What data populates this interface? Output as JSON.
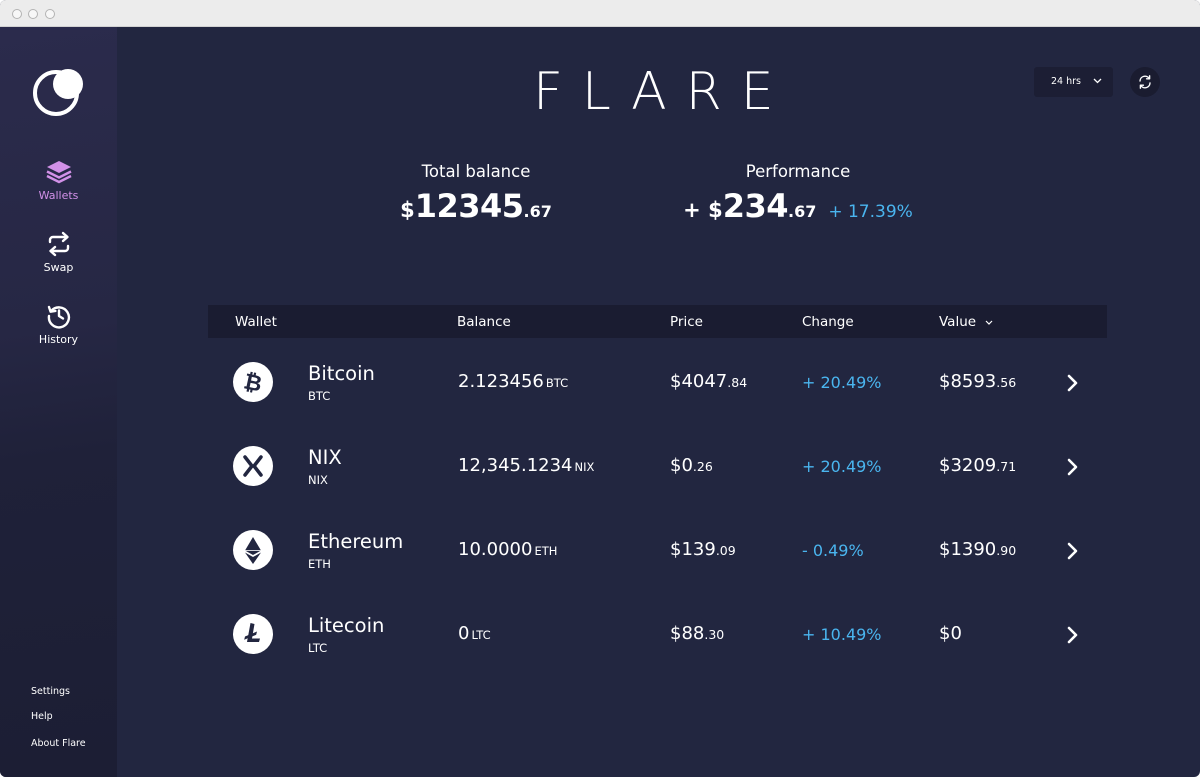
{
  "app": {
    "brand": "FLARE"
  },
  "sidebar": {
    "nav": [
      {
        "label": "Wallets",
        "icon": "layers-icon",
        "active": true
      },
      {
        "label": "Swap",
        "icon": "swap-arrows-icon",
        "active": false
      },
      {
        "label": "History",
        "icon": "history-clock-icon",
        "active": false
      }
    ],
    "footer": [
      "Settings",
      "Help",
      "About Flare"
    ]
  },
  "header": {
    "range": "24 hrs"
  },
  "summary": {
    "total_label": "Total balance",
    "total_currency": "$",
    "total_whole": "12345",
    "total_cents": ".67",
    "perf_label": "Performance",
    "perf_prefix": "+ $",
    "perf_whole": "234",
    "perf_cents": ".67",
    "perf_percent": "+ 17.39%"
  },
  "table": {
    "headers": {
      "wallet": "Wallet",
      "balance": "Balance",
      "price": "Price",
      "change": "Change",
      "value": "Value"
    },
    "rows": [
      {
        "name": "Bitcoin",
        "symbol": "BTC",
        "icon": "bitcoin-icon",
        "balance": "2.123456",
        "unit": "BTC",
        "price_whole": "$4047",
        "price_cents": ".84",
        "change": "+ 20.49%",
        "value_whole": "$8593",
        "value_cents": ".56"
      },
      {
        "name": "NIX",
        "symbol": "NIX",
        "icon": "nix-icon",
        "balance": "12,345.1234",
        "unit": "NIX",
        "price_whole": "$0",
        "price_cents": ".26",
        "change": "+ 20.49%",
        "value_whole": "$3209",
        "value_cents": ".71"
      },
      {
        "name": "Ethereum",
        "symbol": "ETH",
        "icon": "ethereum-icon",
        "balance": "10.0000",
        "unit": "ETH",
        "price_whole": "$139",
        "price_cents": ".09",
        "change": "- 0.49%",
        "value_whole": "$1390",
        "value_cents": ".90"
      },
      {
        "name": "Litecoin",
        "symbol": "LTC",
        "icon": "litecoin-icon",
        "balance": "0",
        "unit": "LTC",
        "price_whole": "$88",
        "price_cents": ".30",
        "change": "+ 10.49%",
        "value_whole": "$0",
        "value_cents": ""
      }
    ]
  },
  "colors": {
    "background": "#222640",
    "accent": "#d291e8",
    "positive": "#4ab5ef",
    "header_row": "#1a1c31"
  }
}
